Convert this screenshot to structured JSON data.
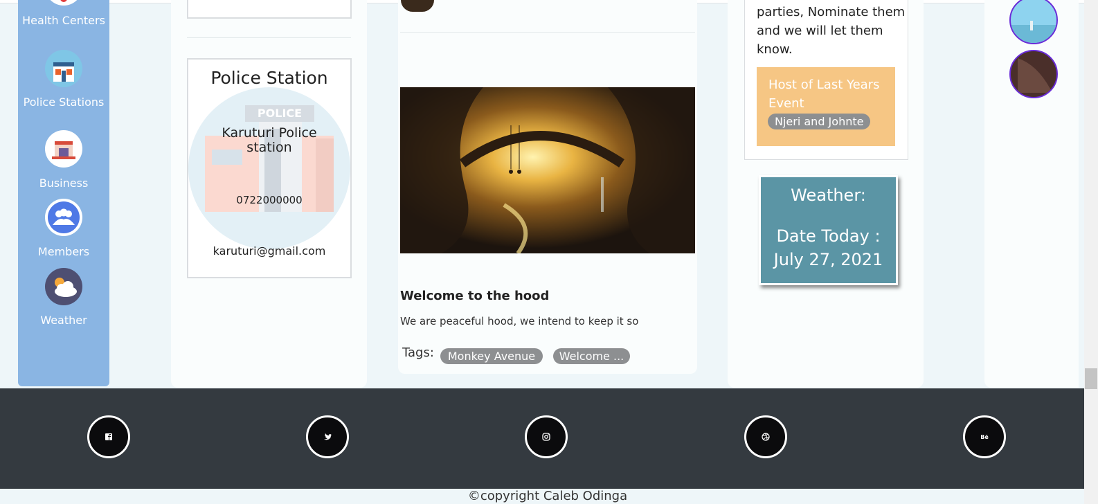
{
  "sidebar": {
    "items": [
      {
        "label": "Health Centers",
        "icon": "health-centers-icon"
      },
      {
        "label": "Police Stations",
        "icon": "police-stations-icon"
      },
      {
        "label": "Business",
        "icon": "business-icon"
      },
      {
        "label": "Members",
        "icon": "members-icon"
      },
      {
        "label": "Weather",
        "icon": "weather-icon"
      }
    ]
  },
  "police_card": {
    "title": "Police Station",
    "sign": "POLICE",
    "name": "Karuturi Police station",
    "phone": "0722000000",
    "email": "karuturi@gmail.com"
  },
  "post": {
    "title": "Welcome to the hood",
    "description": "We are peaceful hood, we intend to keep it so",
    "tags_label": "Tags:",
    "tags": [
      "Monkey Avenue",
      "Welcome ..."
    ]
  },
  "nominate": {
    "text": "parties, Nominate them and we will let them know.",
    "host_label": "Host of Last Years Event",
    "host_value": "Njeri and Johnte"
  },
  "weather": {
    "title": "Weather:",
    "date": "Date Today : July 27, 2021"
  },
  "footer": {
    "social": [
      {
        "icon": "facebook-icon",
        "glyph": "f"
      },
      {
        "icon": "twitter-icon",
        "glyph": "t"
      },
      {
        "icon": "instagram-icon",
        "glyph": "ig"
      },
      {
        "icon": "dribbble-icon",
        "glyph": "d"
      },
      {
        "icon": "behance-icon",
        "glyph": "Bē"
      }
    ],
    "copyright": "©copyright Caleb Odinga"
  },
  "colors": {
    "sidebar": "#8ab5e3",
    "footer": "#343a40",
    "weather_card": "#5b95a5",
    "host_box": "#f6c684",
    "badge": "#8d8f91",
    "avatar_ring": "#6a2cd8"
  }
}
